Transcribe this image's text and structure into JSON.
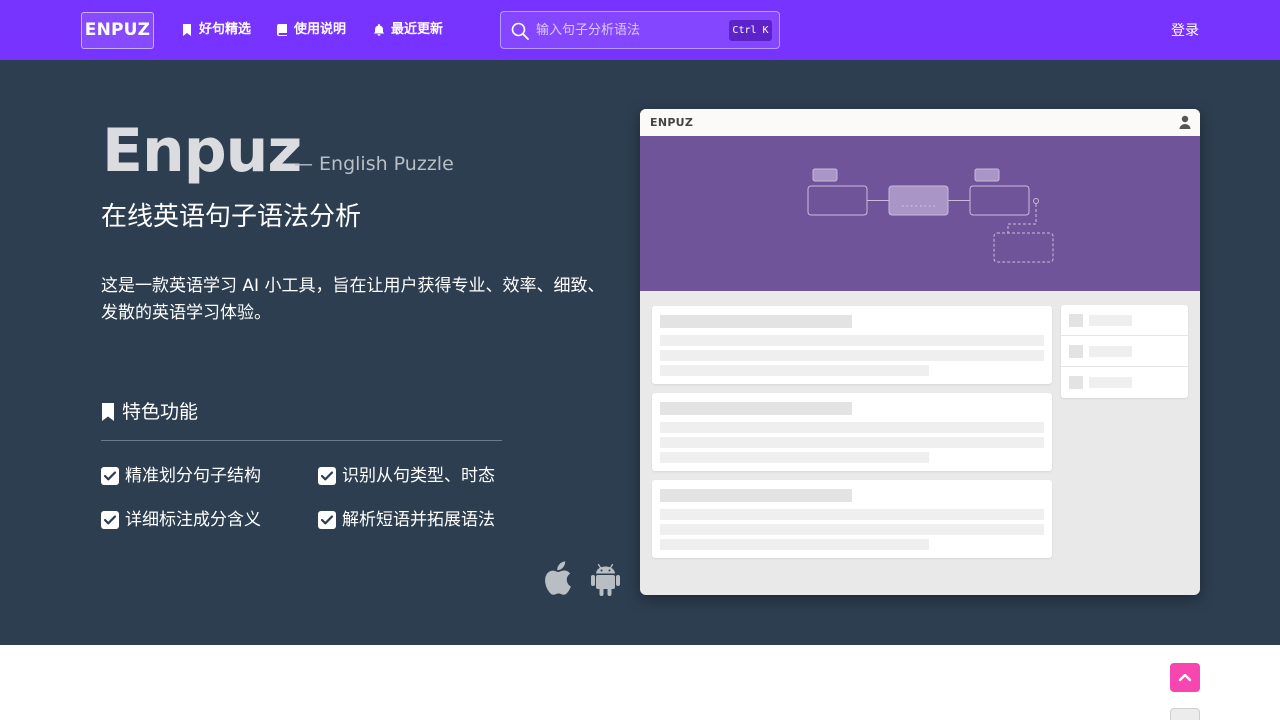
{
  "navbar": {
    "brand": "ENPUZ",
    "links": [
      {
        "label": "好句精选",
        "icon": "bookmark-icon"
      },
      {
        "label": "使用说明",
        "icon": "book-icon"
      },
      {
        "label": "最近更新",
        "icon": "bell-icon"
      }
    ],
    "search": {
      "placeholder": "输入句子分析语法",
      "shortcut_mod": "Ctrl",
      "shortcut_key": "K"
    },
    "login": "登录"
  },
  "hero": {
    "title": "Enpuz",
    "tagline": "— English Puzzle",
    "subtitle": "在线英语句子语法分析",
    "description_line1": "这是一款英语学习 AI 小工具，旨在让用户获得专业、效率、细致、",
    "description_line2": "发散的英语学习体验。",
    "features_heading": "特色功能",
    "features": [
      "精准划分句子结构",
      "识别从句类型、时态",
      "详细标注成分含义",
      "解析短语并拓展语法"
    ],
    "platform_icons": [
      "apple-icon",
      "android-icon"
    ]
  },
  "mockup": {
    "brand": "ENPUZ"
  },
  "colors": {
    "navbar": "#7733ff",
    "hero_bg": "#2d3e50",
    "mock_purple": "#6f5499",
    "to_top": "#f746b0"
  }
}
